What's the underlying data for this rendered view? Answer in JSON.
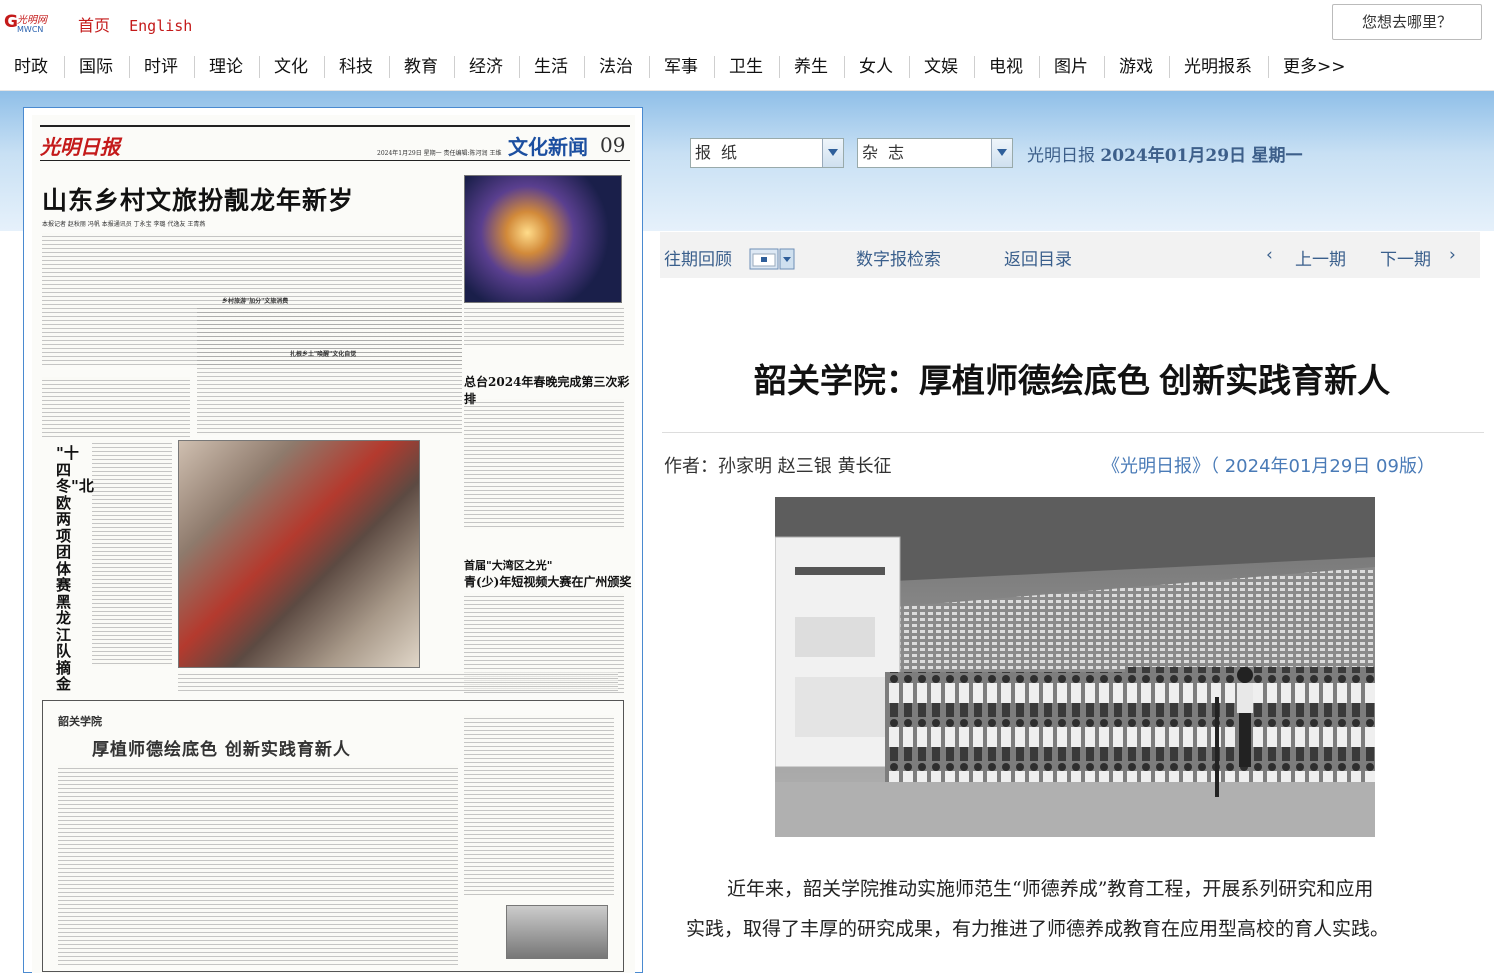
{
  "header": {
    "logo_text": "光明网 GMW.cn",
    "home": "首页",
    "english": "English",
    "search_placeholder": "您想去哪里？"
  },
  "nav": [
    "时政",
    "国际",
    "时评",
    "理论",
    "文化",
    "科技",
    "教育",
    "经济",
    "生活",
    "法治",
    "军事",
    "卫生",
    "养生",
    "女人",
    "文娱",
    "电视",
    "图片",
    "游戏",
    "光明报系",
    "更多>>"
  ],
  "paper": {
    "masthead": "光明日报",
    "dateline": "2024年1月29日 星期一 责任编辑:陈河润 王维",
    "section": "文化新闻",
    "page_no": "09",
    "headline": "山东乡村文旅扮靓龙年新岁",
    "byline": "本报记者 赵秋丽 冯帆 本报通讯员 丁永宝 李璐 代逸友 王青燕",
    "sub1": "乡村旅游\"加分\"文旅消费",
    "sub2": "扎根乡土\"唤醒\"文化自觉",
    "headline2": "总台2024年春晚完成第三次彩排",
    "headline3a": "首届\"大湾区之光\"",
    "headline3b": "青(少)年短视频大赛在广州颁奖",
    "vertical_headline": "\"十四冬\"北欧两项团体赛黑龙江队摘金",
    "box_label": "韶关学院",
    "box_title": "厚植师德绘底色 创新实践育新人"
  },
  "selectors": {
    "newspaper": "报纸",
    "magazine": "杂志"
  },
  "date_info": {
    "paper": "光明日报",
    "date": "2024年01月29日",
    "weekday": "星期一"
  },
  "toolbar": {
    "past": "往期回顾",
    "search": "数字报检索",
    "toc": "返回目录",
    "prev": "上一期",
    "next": "下一期"
  },
  "article": {
    "title": "韶关学院：厚植师德绘底色 创新实践育新人",
    "author": "作者：孙家明  赵三银  黄长征",
    "source": "《光明日报》（ 2024年01月29日  09版）",
    "para1_line1": "近年来，韶关学院推动实施师范生“师德养成”教育工程，开展系列研究和应用",
    "para1_line2": "实践，取得了丰厚的研究成果，有力推进了师德养成教育在应用型高校的育人实践。"
  },
  "colors": {
    "brand_red": "#c41a1a",
    "link_blue": "#3a5f8c",
    "section_blue": "#1c4fa0"
  }
}
